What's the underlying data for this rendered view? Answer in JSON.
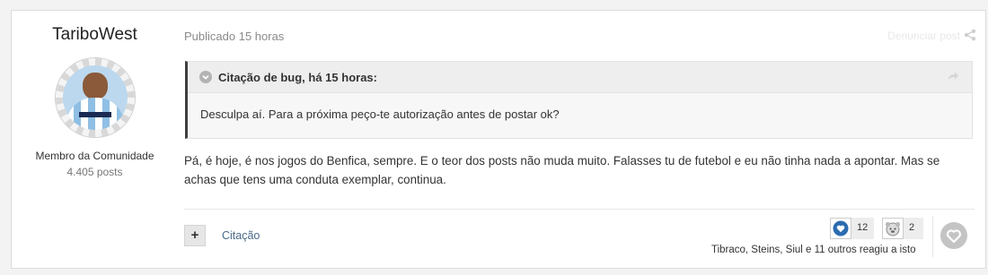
{
  "author": {
    "name": "TariboWest",
    "role": "Membro da Comunidade",
    "post_count": "4.405 posts"
  },
  "post": {
    "published": "Publicado 15 horas",
    "report_label": "Denunciar post",
    "quote": {
      "header": "Citação de bug, há 15 horas:",
      "text": "Desculpa aí. Para a próxima peço-te autorização antes de postar ok?"
    },
    "body": "Pá, é hoje, é nos jogos do Benfica, sempre. E o teor dos posts não muda muito. Falasses tu de futebol e eu não tinha nada a apontar. Mas se achas que tens uma conduta exemplar, continua."
  },
  "actions": {
    "multiquote_label": "+",
    "quote_label": "Citação"
  },
  "reactions": {
    "items": [
      {
        "icon": "heart-icon",
        "count": "12",
        "color": "#2b6cb0"
      },
      {
        "icon": "thanks-icon",
        "count": "2",
        "color": "#888888"
      }
    ],
    "summary": "Tibraco, Steins, Siul e 11 outros reagiu a isto"
  },
  "colors": {
    "accent": "#2b6cb0",
    "link": "#4a6a8a",
    "quote_border": "#3e3e3e"
  }
}
